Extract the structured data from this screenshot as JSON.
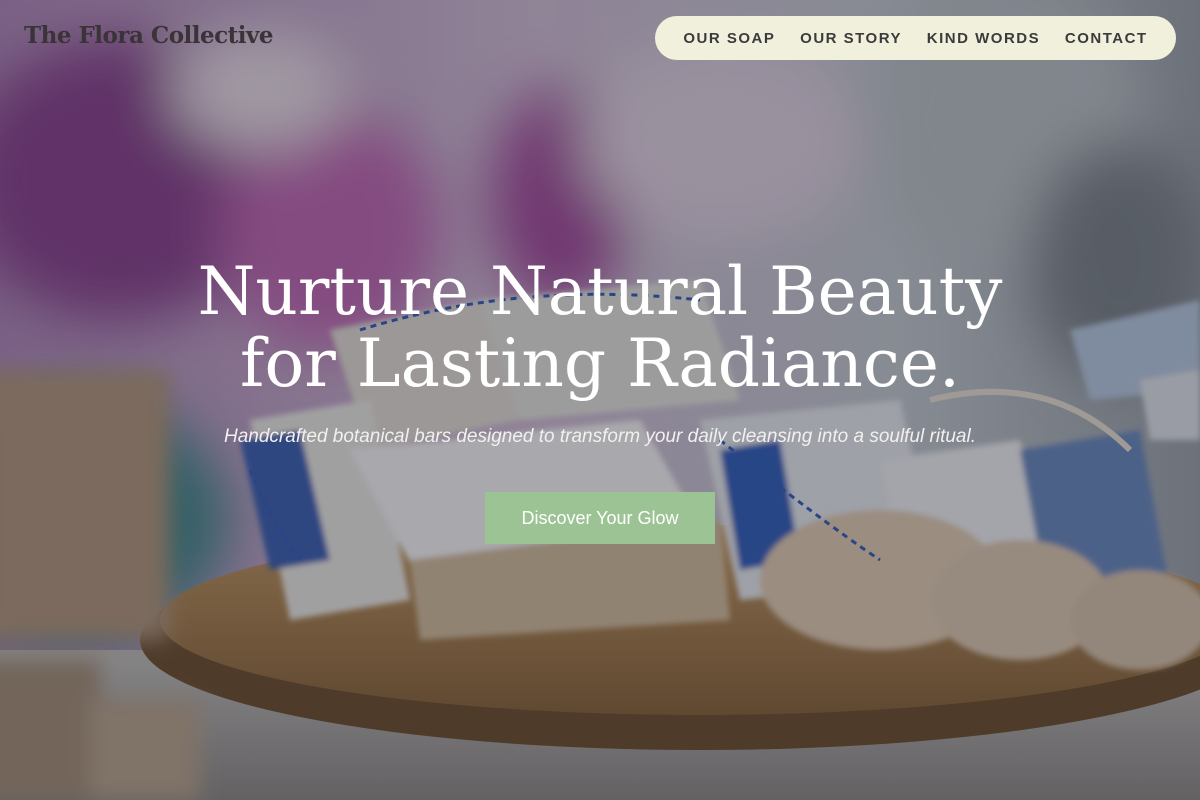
{
  "brand": {
    "name": "The Flora Collective"
  },
  "nav": {
    "items": [
      {
        "label": "OUR SOAP"
      },
      {
        "label": "OUR STORY"
      },
      {
        "label": "KIND WORDS"
      },
      {
        "label": "CONTACT"
      }
    ]
  },
  "hero": {
    "headline_line1": "Nurture Natural Beauty",
    "headline_line2": "for Lasting Radiance.",
    "subtitle": "Handcrafted botanical bars designed to transform your daily cleansing into a soulful ritual.",
    "cta_label": "Discover Your Glow",
    "background_image": "handmade-soap-bars-on-wooden-tray"
  },
  "colors": {
    "nav_pill_bg": "#f0f0dc",
    "cta_bg": "#9cc394",
    "brand_text": "#3a3338",
    "headline_text": "#ffffff"
  }
}
